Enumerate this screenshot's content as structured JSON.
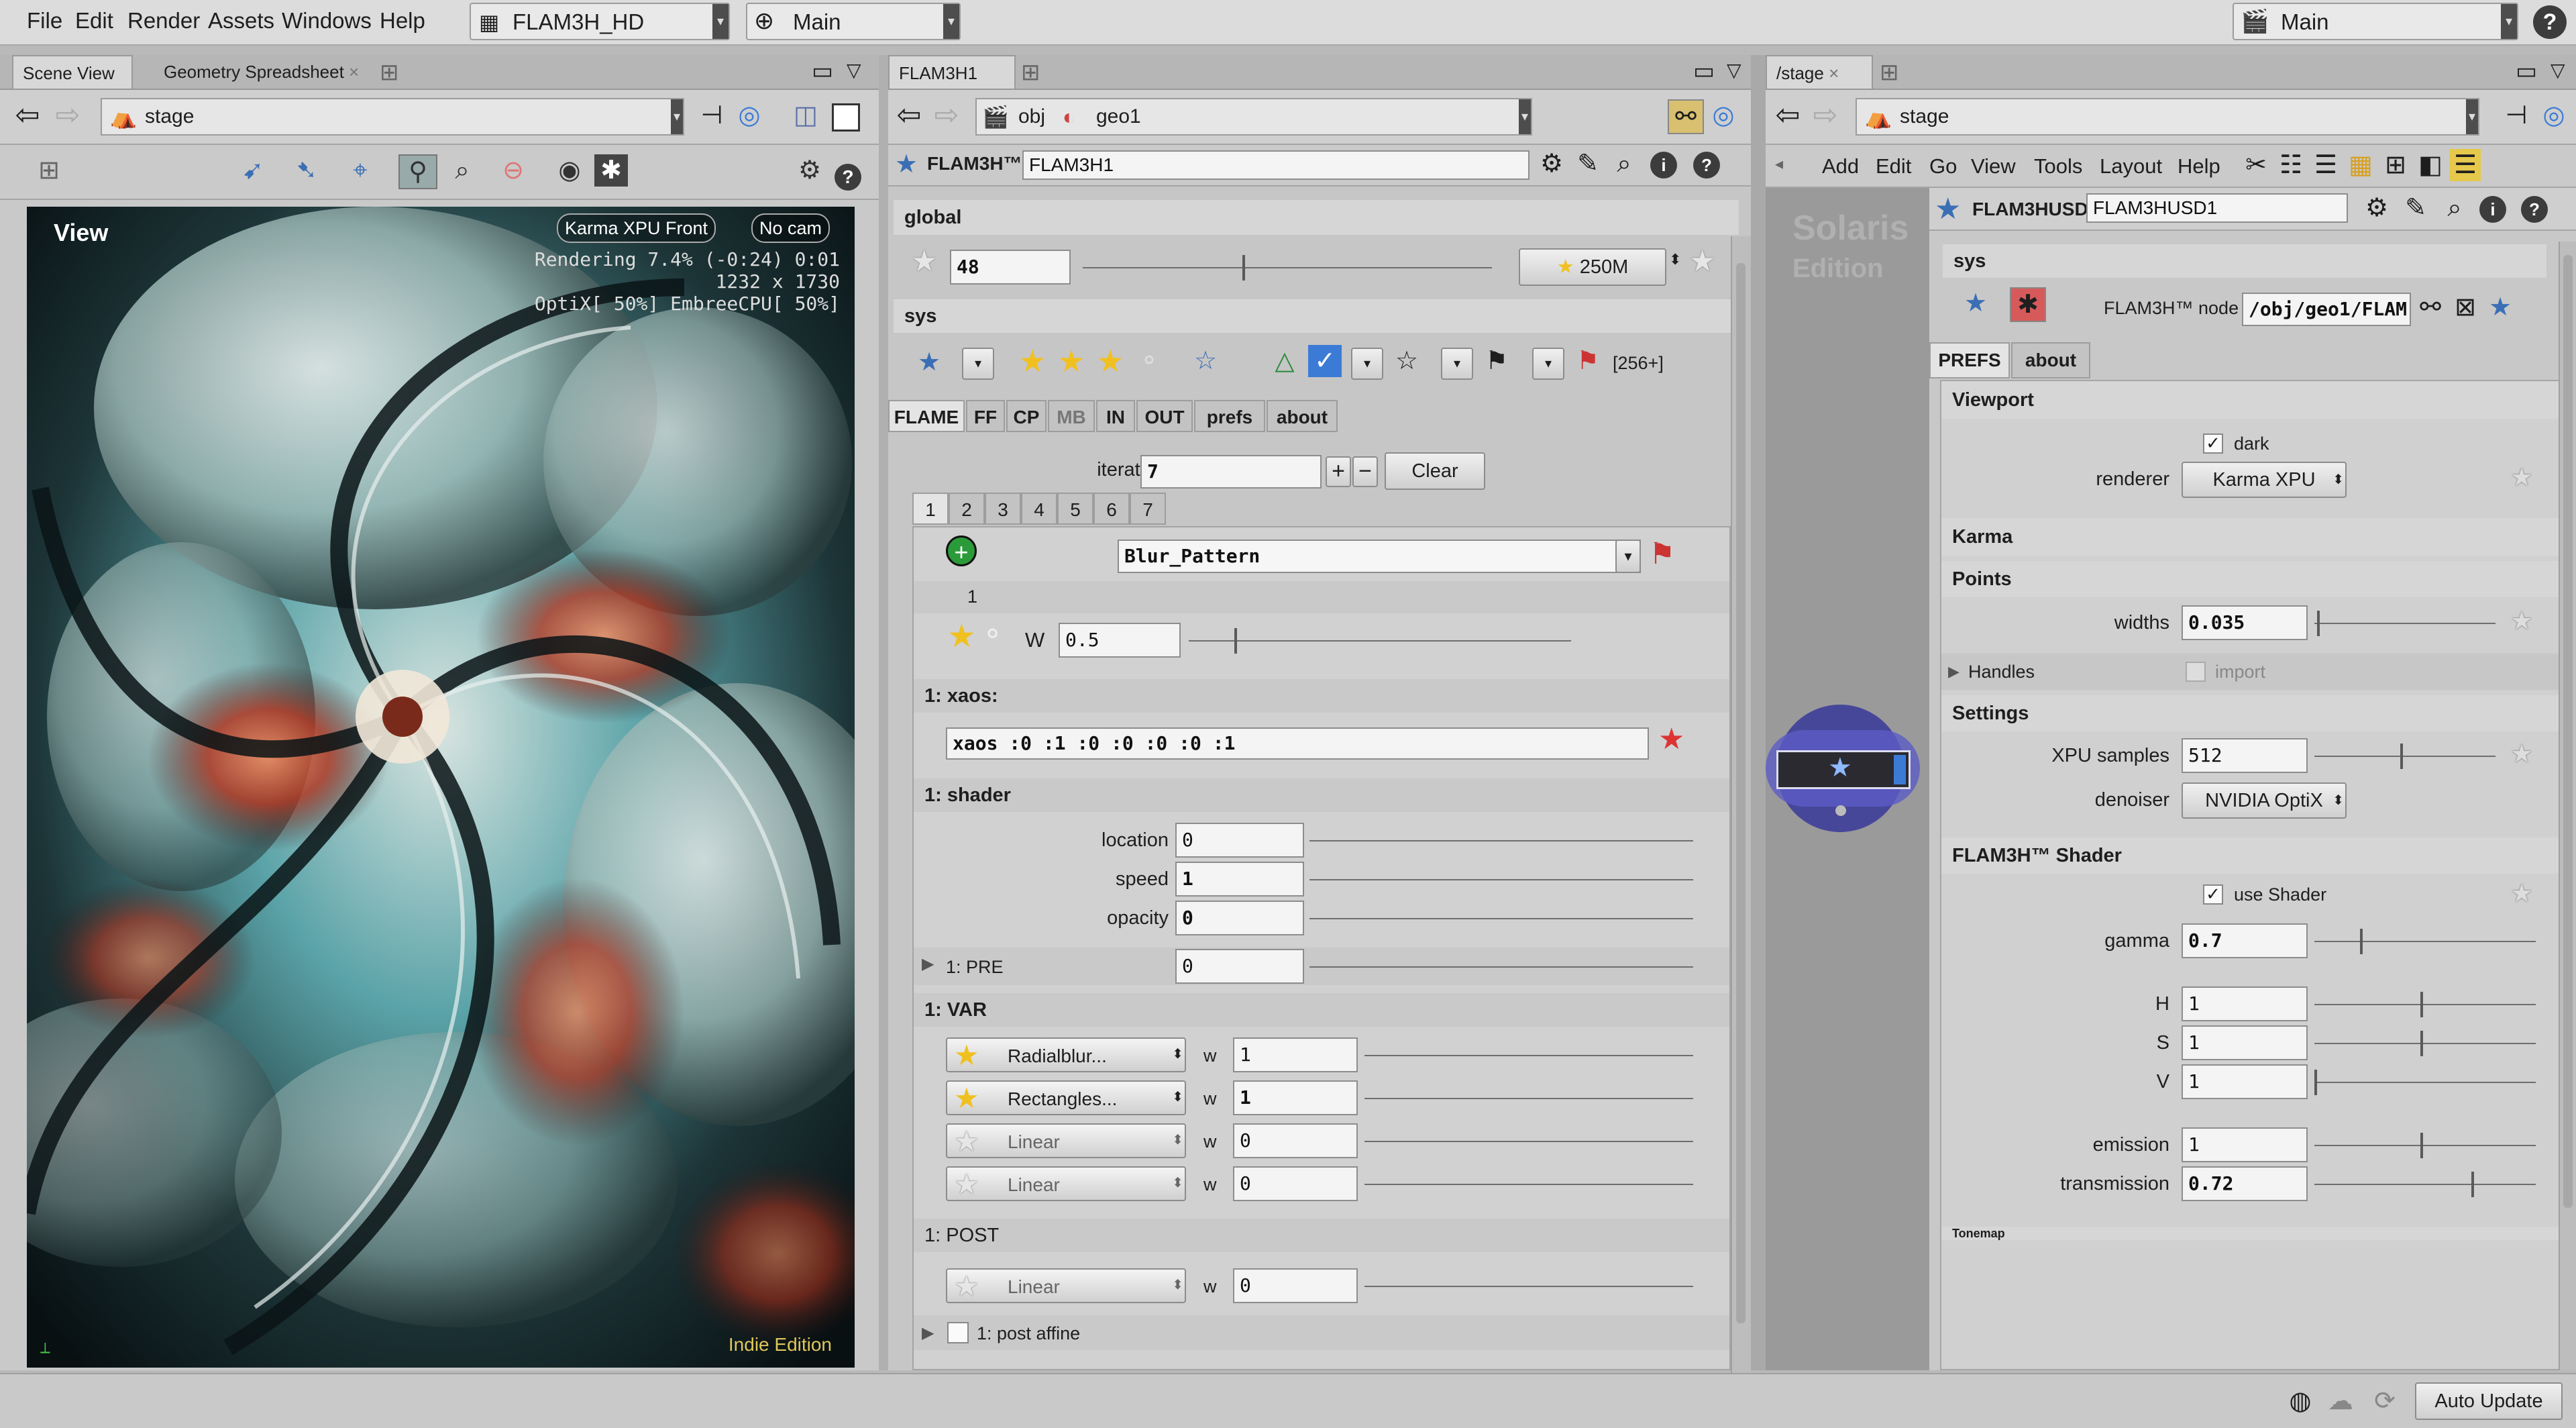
{
  "menubar": {
    "items": [
      "File",
      "Edit",
      "Render",
      "Assets",
      "Windows",
      "Help"
    ],
    "desktop": "FLAM3H_HD",
    "network": "Main",
    "right_desktop": "Main"
  },
  "left": {
    "tabs": [
      "Scene View",
      "Geometry Spreadsheet"
    ],
    "path": "stage",
    "view_label": "View",
    "cam_labels": [
      "Karma XPU  Front",
      "No cam"
    ],
    "render_info": [
      "Rendering  7.4%  (-0:24)  0:01",
      "1232 x 1730",
      "OptiX[ 50%] EmbreeCPU[ 50%]"
    ],
    "edition": "Indie Edition"
  },
  "mid": {
    "tab": "FLAM3H1",
    "path_obj": "obj",
    "path_geo": "geo1",
    "node_type": "FLAM3H™",
    "node_name": "FLAM3H1",
    "global_label": "global",
    "global_value": "48",
    "global_iter": "250M",
    "sys_label": "sys",
    "sys_count": "[256+]",
    "tabs": [
      "FLAME",
      "FF",
      "CP",
      "MB",
      "IN",
      "OUT",
      "prefs",
      "about"
    ],
    "iterators_label": "iterators",
    "iterators_value": "7",
    "clear_label": "Clear",
    "iter_tabs": [
      "1",
      "2",
      "3",
      "4",
      "5",
      "6",
      "7"
    ],
    "iter_name": "Blur_Pattern",
    "iter_index": "1",
    "w_label": "W",
    "w_value": "0.5",
    "xaos_header": "1: xaos:",
    "xaos_value": "xaos :0 :1 :0 :0 :0 :0 :1",
    "shader_header": "1: shader",
    "location_label": "location",
    "location_value": "0",
    "speed_label": "speed",
    "speed_value": "1",
    "opacity_label": "opacity",
    "opacity_value": "0",
    "pre_label": "1: PRE",
    "pre_value": "0",
    "var_header": "1: VAR",
    "vars": [
      {
        "name": "Radialblur...",
        "w": "1",
        "active": true
      },
      {
        "name": "Rectangles...",
        "w": "1",
        "active": true
      },
      {
        "name": "Linear",
        "w": "0",
        "active": false
      },
      {
        "name": "Linear",
        "w": "0",
        "active": false
      }
    ],
    "post_header": "1: POST",
    "post_var": {
      "name": "Linear",
      "w": "0"
    },
    "post_affine": "1: post affine",
    "w_small": "w"
  },
  "right": {
    "tab": "/stage",
    "path": "stage",
    "menu": [
      "Add",
      "Edit",
      "Go",
      "View",
      "Tools",
      "Layout",
      "Help"
    ],
    "network_watermark": [
      "Solaris",
      "Edition"
    ],
    "node_type": "FLAM3HUSD",
    "node_name": "FLAM3HUSD1",
    "sys_label": "sys",
    "node_label": "FLAM3H™ node",
    "node_path": "/obj/geo1/FLAM",
    "tabs": [
      "PREFS",
      "about"
    ],
    "viewport_header": "Viewport",
    "dark_label": "dark",
    "renderer_label": "renderer",
    "renderer_value": "Karma XPU",
    "karma_header": "Karma",
    "points_header": "Points",
    "widths_label": "widths",
    "widths_value": "0.035",
    "handles_label": "Handles",
    "import_label": "import",
    "settings_header": "Settings",
    "xpu_label": "XPU samples",
    "xpu_value": "512",
    "denoiser_label": "denoiser",
    "denoiser_value": "NVIDIA OptiX",
    "shader_header": "FLAM3H™ Shader",
    "use_shader_label": "use Shader",
    "gamma_label": "gamma",
    "gamma_value": "0.7",
    "h_label": "H",
    "h_value": "1",
    "s_label": "S",
    "s_value": "1",
    "v_label": "V",
    "v_value": "1",
    "emission_label": "emission",
    "emission_value": "1",
    "transmission_label": "transmission",
    "transmission_value": "0.72",
    "tonemap_label": "Tonemap"
  },
  "status": {
    "auto_update": "Auto Update"
  }
}
